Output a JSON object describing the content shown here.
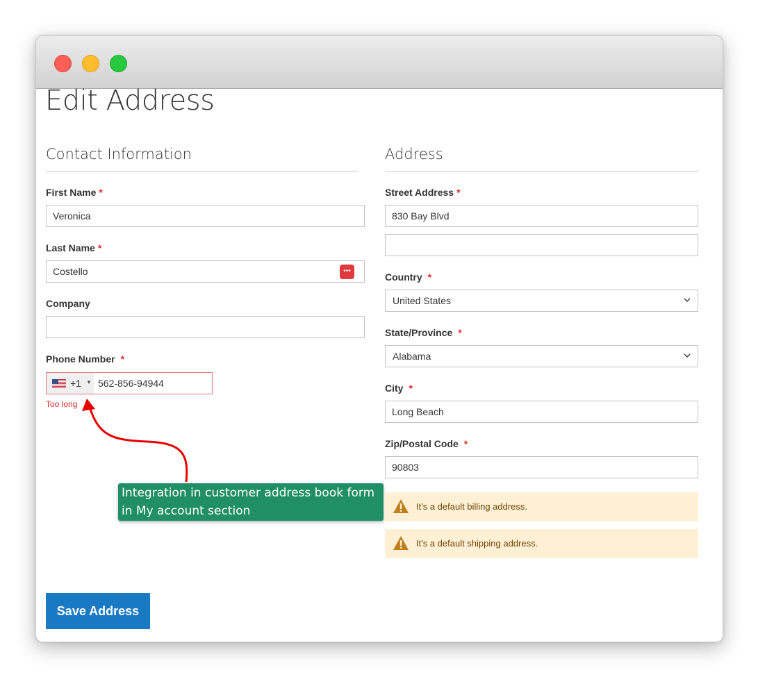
{
  "page": {
    "title": "Edit Address"
  },
  "contact": {
    "section_title": "Contact Information",
    "first_name_label": "First Name",
    "first_name_value": "Veronica",
    "last_name_label": "Last Name",
    "last_name_value": "Costello",
    "company_label": "Company",
    "company_value": "",
    "phone_label": "Phone Number",
    "phone_dial_code": "+1",
    "phone_value": "562-856-94944",
    "phone_error": "Too long"
  },
  "address": {
    "section_title": "Address",
    "street_label": "Street Address",
    "street_line1": "830 Bay Blvd",
    "street_line2": "",
    "country_label": "Country",
    "country_value": "United States",
    "state_label": "State/Province",
    "state_value": "Alabama",
    "city_label": "City",
    "city_value": "Long Beach",
    "zip_label": "Zip/Postal Code",
    "zip_value": "90803",
    "billing_notice": "It's a default billing address.",
    "shipping_notice": "It's a default shipping address."
  },
  "required_mark": "*",
  "callout": {
    "line1": "Integration in customer address book form",
    "line2": "in My account section"
  },
  "actions": {
    "save_label": "Save Address"
  },
  "colors": {
    "primary_button": "#1979c3",
    "error": "#e02b27",
    "callout_bg": "#208f68",
    "notice_bg": "#fdf0d5",
    "notice_icon": "#c07f1e"
  }
}
